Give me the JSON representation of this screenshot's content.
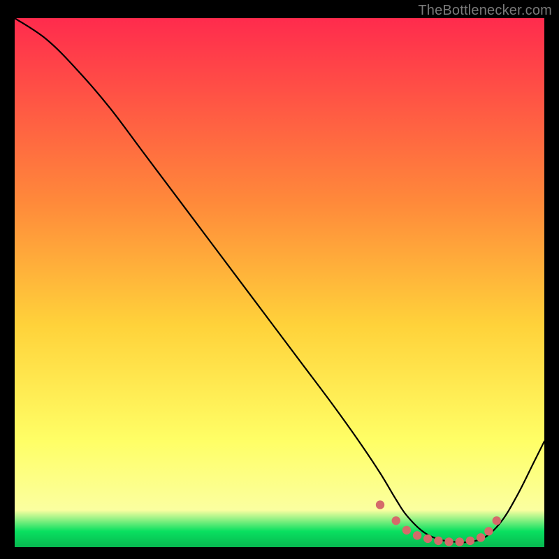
{
  "attribution": "TheBottlenecker.com",
  "colors": {
    "bg": "#000000",
    "attribution_text": "#7a7a7a",
    "curve_stroke": "#000000",
    "marker_fill": "#d56a6a",
    "marker_stroke": "#c05a5a",
    "gradient_top": "#ff2b4d",
    "gradient_mid1": "#ff8a3a",
    "gradient_mid2": "#ffd23a",
    "gradient_mid3": "#ffff66",
    "gradient_mid4": "#fbffa0",
    "gradient_bottom": "#09e060",
    "gradient_bottom2": "#07b850"
  },
  "chart_data": {
    "type": "line",
    "title": "",
    "xlabel": "",
    "ylabel": "",
    "xlim": [
      0,
      100
    ],
    "ylim": [
      0,
      100
    ],
    "series": [
      {
        "name": "bottleneck-curve",
        "x": [
          0,
          6,
          12,
          18,
          24,
          30,
          36,
          42,
          48,
          54,
          60,
          65,
          69,
          72,
          74,
          77,
          80,
          83,
          86,
          89,
          92,
          95,
          98,
          100
        ],
        "y": [
          100,
          96,
          90,
          83,
          75,
          67,
          59,
          51,
          43,
          35,
          27,
          20,
          14,
          9,
          6,
          3,
          1.5,
          1,
          1,
          2,
          5,
          10,
          16,
          20
        ]
      }
    ],
    "markers": {
      "name": "sweet-spot",
      "x": [
        69,
        72,
        74,
        76,
        78,
        80,
        82,
        84,
        86,
        88,
        89.5,
        91
      ],
      "y": [
        8.0,
        5.0,
        3.2,
        2.2,
        1.6,
        1.2,
        1.0,
        1.0,
        1.2,
        1.8,
        3.0,
        5.0
      ]
    }
  }
}
